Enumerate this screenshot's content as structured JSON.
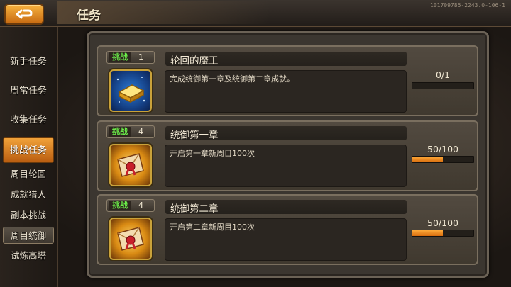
{
  "header": {
    "title": "任务",
    "version": "101709785-2243.0-106-1"
  },
  "sidebar": {
    "main_items": [
      {
        "label": "新手任务",
        "active": false
      },
      {
        "label": "周常任务",
        "active": false
      },
      {
        "label": "收集任务",
        "active": false
      },
      {
        "label": "挑战任务",
        "active": true
      }
    ],
    "sub_items": [
      {
        "label": "周目轮回",
        "active": false
      },
      {
        "label": "成就猎人",
        "active": false
      },
      {
        "label": "副本挑战",
        "active": false
      },
      {
        "label": "周目统御",
        "active": true
      },
      {
        "label": "试炼高塔",
        "active": false
      }
    ]
  },
  "quests": [
    {
      "tag_label": "挑战",
      "tag_number": "1",
      "name": "轮回的魔王",
      "description": "完成统御第一章及统御第二章成就。",
      "progress_text": "0/1",
      "progress_fraction": 0.0,
      "icon": "gold-bar-icon"
    },
    {
      "tag_label": "挑战",
      "tag_number": "4",
      "name": "统御第一章",
      "description": "开启第一章新周目100次",
      "progress_text": "50/100",
      "progress_fraction": 0.5,
      "icon": "scroll-letter-icon"
    },
    {
      "tag_label": "挑战",
      "tag_number": "4",
      "name": "统御第二章",
      "description": "开启第二章新周目100次",
      "progress_text": "50/100",
      "progress_fraction": 0.5,
      "icon": "scroll-letter-icon"
    }
  ],
  "colors": {
    "accent_orange": "#e6861c",
    "tag_green": "#6cf04a",
    "progress_fill": "#f29a2a"
  }
}
